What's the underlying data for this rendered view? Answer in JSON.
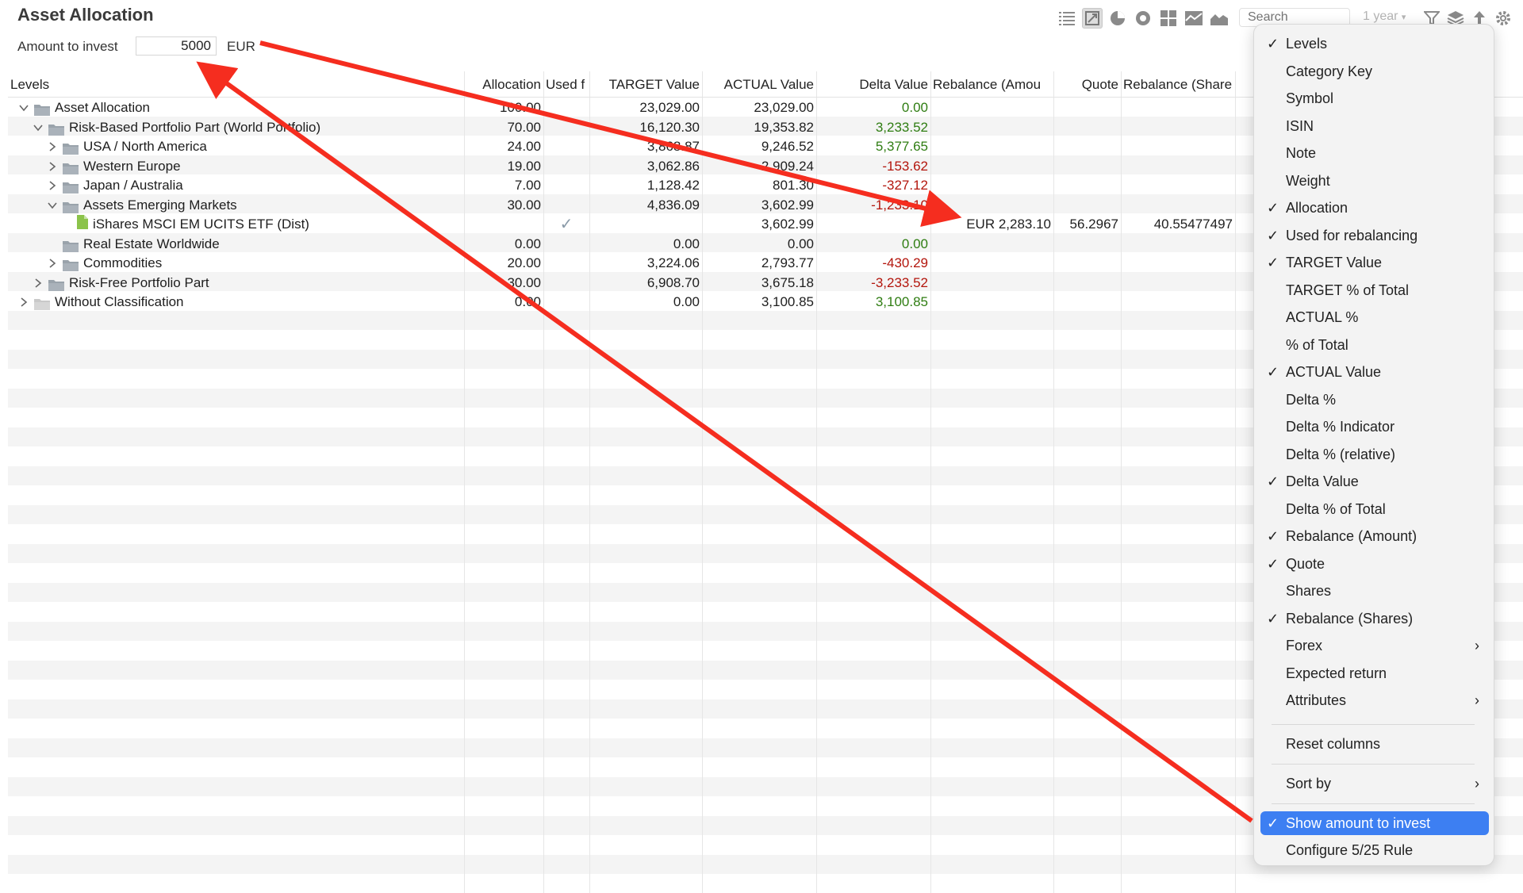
{
  "title": "Asset Allocation",
  "invest": {
    "label": "Amount to invest",
    "value": "5000",
    "currency": "EUR"
  },
  "toolbar": {
    "icons": [
      "list-icon",
      "pivot-icon",
      "pie-chart-icon",
      "donut-chart-icon",
      "treemap-icon",
      "stacked-area-icon",
      "area-chart-icon"
    ],
    "search_placeholder": "Search",
    "period": "1 year",
    "right_icons": [
      "filter-icon",
      "layers-icon",
      "export-icon",
      "settings-icon"
    ]
  },
  "columns": [
    "Levels",
    "Allocation",
    "Used f",
    "TARGET Value",
    "ACTUAL Value",
    "Delta Value",
    "Rebalance (Amou",
    "Quote",
    "Rebalance (Share"
  ],
  "rows": [
    {
      "name": "Asset Allocation",
      "alloc": "100.00",
      "target": "23,029.00",
      "actual": "23,029.00",
      "delta": "0.00",
      "delta_sign": "pos"
    },
    {
      "name": "Risk-Based Portfolio Part (World Portfolio)",
      "alloc": "70.00",
      "target": "16,120.30",
      "actual": "19,353.82",
      "delta": "3,233.52",
      "delta_sign": "pos"
    },
    {
      "name": "USA / North America",
      "alloc": "24.00",
      "target": "3,868.87",
      "actual": "9,246.52",
      "delta": "5,377.65",
      "delta_sign": "pos"
    },
    {
      "name": "Western Europe",
      "alloc": "19.00",
      "target": "3,062.86",
      "actual": "2,909.24",
      "delta": "-153.62",
      "delta_sign": "neg"
    },
    {
      "name": "Japan / Australia",
      "alloc": "7.00",
      "target": "1,128.42",
      "actual": "801.30",
      "delta": "-327.12",
      "delta_sign": "neg"
    },
    {
      "name": "Assets Emerging Markets",
      "alloc": "30.00",
      "target": "4,836.09",
      "actual": "3,602.99",
      "delta": "-1,233.10",
      "delta_sign": "neg"
    },
    {
      "name": "iShares MSCI EM UCITS ETF (Dist)",
      "alloc": "",
      "used": "✓",
      "target": "",
      "actual": "3,602.99",
      "delta": "",
      "delta_sign": "",
      "rebalance": "EUR 2,283.10",
      "quote": "56.2967",
      "rebal_shares": "40.55477497"
    },
    {
      "name": "Real Estate Worldwide",
      "alloc": "0.00",
      "target": "0.00",
      "actual": "0.00",
      "delta": "0.00",
      "delta_sign": "pos"
    },
    {
      "name": "Commodities",
      "alloc": "20.00",
      "target": "3,224.06",
      "actual": "2,793.77",
      "delta": "-430.29",
      "delta_sign": "neg"
    },
    {
      "name": "Risk-Free Portfolio Part",
      "alloc": "30.00",
      "target": "6,908.70",
      "actual": "3,675.18",
      "delta": "-3,233.52",
      "delta_sign": "neg"
    },
    {
      "name": "Without Classification",
      "alloc": "0.00",
      "target": "0.00",
      "actual": "3,100.85",
      "delta": "3,100.85",
      "delta_sign": "pos"
    }
  ],
  "menu": {
    "items": [
      {
        "label": "Levels",
        "checked": "✓"
      },
      {
        "label": "Category Key",
        "checked": ""
      },
      {
        "label": "Symbol",
        "checked": ""
      },
      {
        "label": "ISIN",
        "checked": ""
      },
      {
        "label": "Note",
        "checked": ""
      },
      {
        "label": "Weight",
        "checked": ""
      },
      {
        "label": "Allocation",
        "checked": "✓"
      },
      {
        "label": "Used for rebalancing",
        "checked": "✓"
      },
      {
        "label": "TARGET Value",
        "checked": "✓"
      },
      {
        "label": "TARGET % of Total",
        "checked": ""
      },
      {
        "label": "ACTUAL %",
        "checked": ""
      },
      {
        "label": "% of Total",
        "checked": ""
      },
      {
        "label": "ACTUAL Value",
        "checked": "✓"
      },
      {
        "label": "Delta %",
        "checked": ""
      },
      {
        "label": "Delta % Indicator",
        "checked": ""
      },
      {
        "label": "Delta % (relative)",
        "checked": ""
      },
      {
        "label": "Delta Value",
        "checked": "✓"
      },
      {
        "label": "Delta % of Total",
        "checked": ""
      },
      {
        "label": "Rebalance (Amount)",
        "checked": "✓"
      },
      {
        "label": "Quote",
        "checked": "✓"
      },
      {
        "label": "Shares",
        "checked": ""
      },
      {
        "label": "Rebalance (Shares)",
        "checked": "✓"
      },
      {
        "label": "Forex",
        "checked": "",
        "submenu": "›"
      },
      {
        "label": "Expected return",
        "checked": ""
      },
      {
        "label": "Attributes",
        "checked": "",
        "submenu": "›"
      }
    ],
    "reset": "Reset columns",
    "sort_by": "Sort by",
    "sort_by_sub": "›",
    "show_amount": "Show amount to invest",
    "show_amount_checked": "✓",
    "configure": "Configure 5/25 Rule"
  },
  "colors": {
    "positive": "#2f7d12",
    "negative": "#b3150c",
    "highlight": "#3d7ff2",
    "annotation": "#f52d1f"
  }
}
